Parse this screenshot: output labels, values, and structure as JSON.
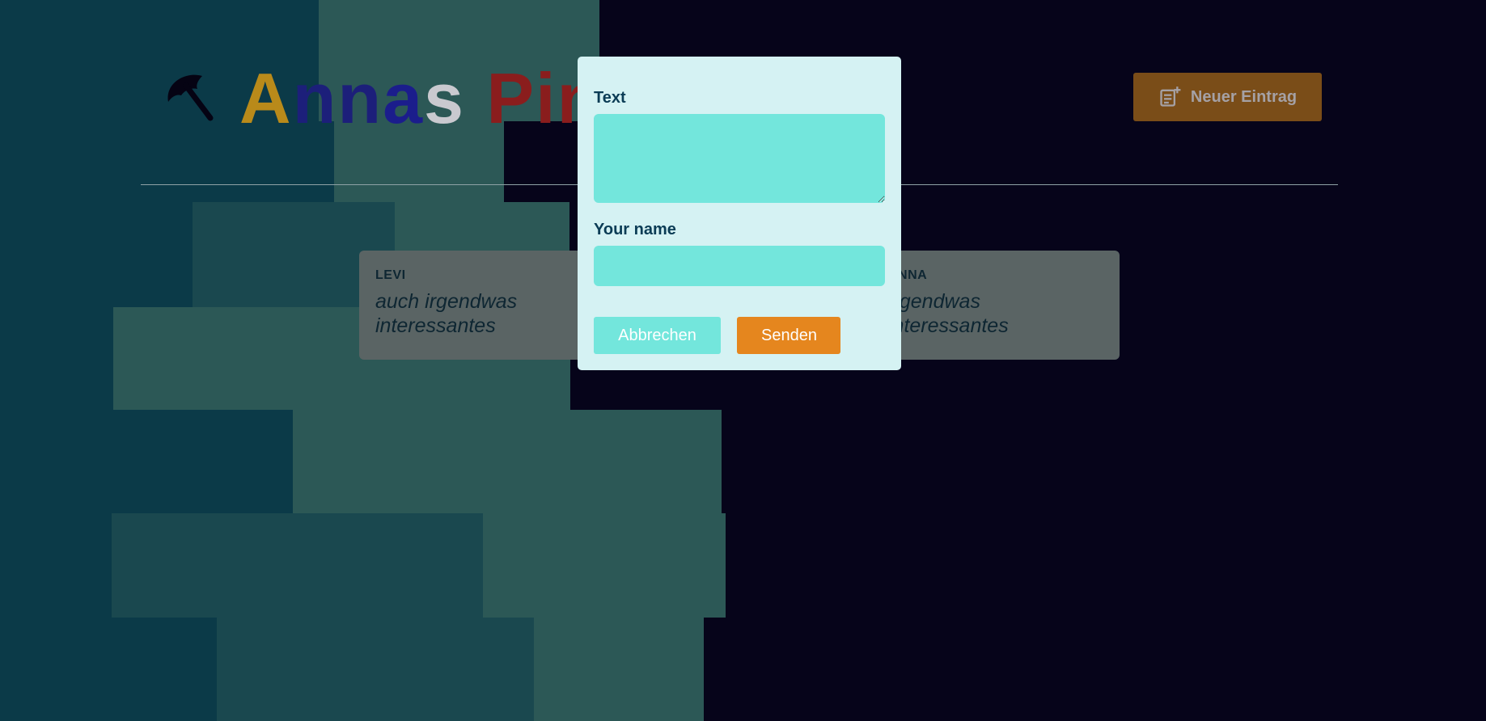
{
  "header": {
    "title_parts": [
      "A",
      "nn",
      "a",
      "s ",
      "Pin"
    ],
    "new_entry_label": "Neuer Eintrag",
    "logo_icon": "umbrella-icon",
    "new_entry_icon": "note-add-icon"
  },
  "cards": [
    {
      "author": "LEVI",
      "text": "auch irgendwas interessantes"
    },
    {
      "author": "ANNA",
      "text": "irgendwas interessantes"
    }
  ],
  "modal": {
    "text_label": "Text",
    "text_value": "",
    "name_label": "Your name",
    "name_value": "",
    "cancel_label": "Abbrechen",
    "send_label": "Senden"
  },
  "colors": {
    "accent": "#e5861e",
    "field_bg": "#73e6dc",
    "modal_bg": "#d5f2f3",
    "label_text": "#0b3c55"
  }
}
